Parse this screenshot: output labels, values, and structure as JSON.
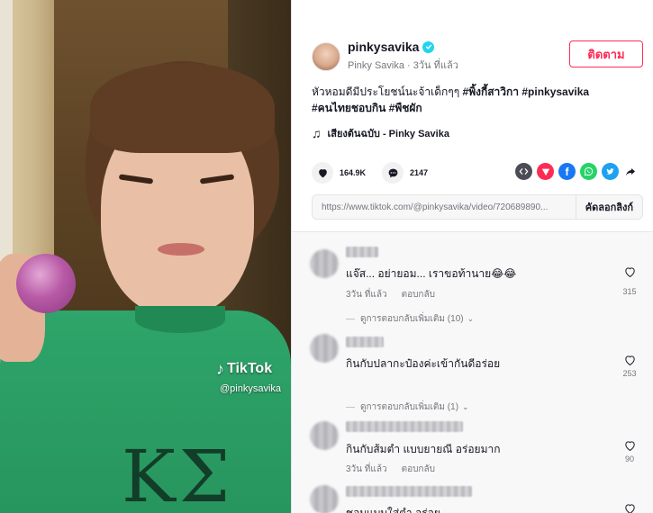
{
  "video": {
    "tiktok_brand": "TikTok",
    "watermark_handle": "@pinkysavika"
  },
  "author": {
    "username": "pinkysavika",
    "display_name": "Pinky Savika",
    "separator": " · ",
    "posted": "3วัน ที่แล้ว",
    "follow_label": "ติดตาม"
  },
  "caption": {
    "text": "หัวหอมดีมีประโยชน์นะจ้าเด็กๆๆ ",
    "tags": [
      "#พิ้งกี้สาวิกา",
      " #pinkysavika",
      "#คนไทยชอบกิน",
      " #พืชผัก"
    ]
  },
  "music": {
    "label": "เสียงต้นฉบับ - Pinky Savika"
  },
  "stats": {
    "likes": "164.9K",
    "comments": "2147"
  },
  "share_icons": [
    "embed-icon",
    "send-icon",
    "facebook-icon",
    "whatsapp-icon",
    "twitter-icon",
    "share-arrow-icon"
  ],
  "colors": {
    "accent": "#fe2c55",
    "verified": "#20d5ec",
    "facebook": "#1877f2",
    "whatsapp": "#25d366",
    "twitter": "#1da1f2",
    "send": "#fe2c55",
    "embed": "#4b4c56"
  },
  "link": {
    "url": "https://www.tiktok.com/@pinkysavika/video/720689890...",
    "copy_label": "คัดลอกลิงก์"
  },
  "comments": [
    {
      "text": "แจ๊ส... อย่ายอม... เราขอท้านาย😂😂",
      "time": "3วัน ที่แล้ว",
      "reply_label": "ตอบกลับ",
      "more_replies": "ดูการตอบกลับเพิ่มเติม (10)",
      "likes": "315"
    },
    {
      "text": "กินกับปลากะป๋องค่ะเข้ากันดีอร่อย",
      "time": "",
      "reply_label": "",
      "more_replies": "ดูการตอบกลับเพิ่มเติม (1)",
      "likes": "253"
    },
    {
      "text": "กินกับส้มตำ แบบยายณี อร่อยมาก",
      "time": "3วัน ที่แล้ว",
      "reply_label": "ตอบกลับ",
      "more_replies": "",
      "likes": "90"
    },
    {
      "text": "ชอบแบบใส่ตำ อร่อย",
      "time": "",
      "reply_label": "",
      "more_replies": "",
      "likes": ""
    }
  ]
}
